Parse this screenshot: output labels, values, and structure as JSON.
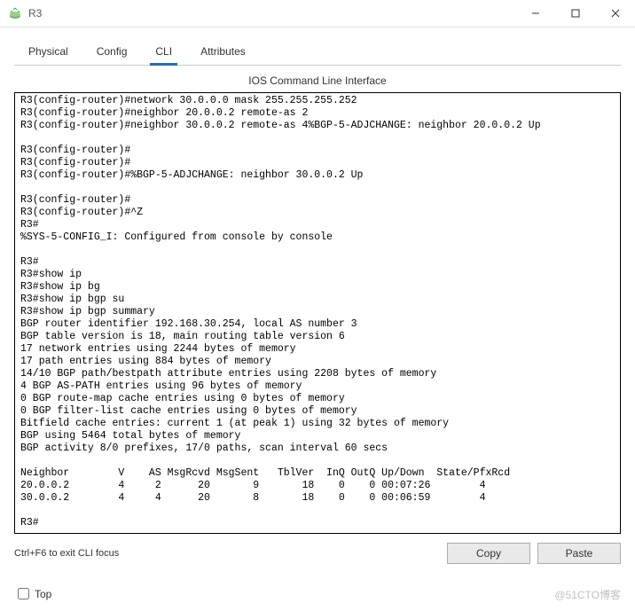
{
  "window": {
    "title": "R3"
  },
  "tabs": {
    "t0": "Physical",
    "t1": "Config",
    "t2": "CLI",
    "t3": "Attributes",
    "active": 2
  },
  "panel": {
    "title": "IOS Command Line Interface"
  },
  "terminal": {
    "lines": [
      "R3(config-router)#network 30.0.0.0 mask 255.255.255.252",
      "R3(config-router)#neighbor 20.0.0.2 remote-as 2",
      "R3(config-router)#neighbor 30.0.0.2 remote-as 4%BGP-5-ADJCHANGE: neighbor 20.0.0.2 Up",
      "",
      "R3(config-router)#",
      "R3(config-router)#",
      "R3(config-router)#%BGP-5-ADJCHANGE: neighbor 30.0.0.2 Up",
      "",
      "R3(config-router)#",
      "R3(config-router)#^Z",
      "R3#",
      "%SYS-5-CONFIG_I: Configured from console by console",
      "",
      "R3#",
      "R3#show ip",
      "R3#show ip bg",
      "R3#show ip bgp su",
      "R3#show ip bgp summary",
      "BGP router identifier 192.168.30.254, local AS number 3",
      "BGP table version is 18, main routing table version 6",
      "17 network entries using 2244 bytes of memory",
      "17 path entries using 884 bytes of memory",
      "14/10 BGP path/bestpath attribute entries using 2208 bytes of memory",
      "4 BGP AS-PATH entries using 96 bytes of memory",
      "0 BGP route-map cache entries using 0 bytes of memory",
      "0 BGP filter-list cache entries using 0 bytes of memory",
      "Bitfield cache entries: current 1 (at peak 1) using 32 bytes of memory",
      "BGP using 5464 total bytes of memory",
      "BGP activity 8/0 prefixes, 17/0 paths, scan interval 60 secs",
      "",
      "Neighbor        V    AS MsgRcvd MsgSent   TblVer  InQ OutQ Up/Down  State/PfxRcd",
      "20.0.0.2        4     2      20       9       18    0    0 00:07:26        4",
      "30.0.0.2        4     4      20       8       18    0    0 00:06:59        4",
      "",
      "R3#"
    ]
  },
  "buttons": {
    "copy": "Copy",
    "paste": "Paste"
  },
  "hints": {
    "exit_focus": "Ctrl+F6 to exit CLI focus"
  },
  "footer": {
    "top_label": "Top",
    "top_checked": false
  },
  "watermark": "@51CTO博客"
}
